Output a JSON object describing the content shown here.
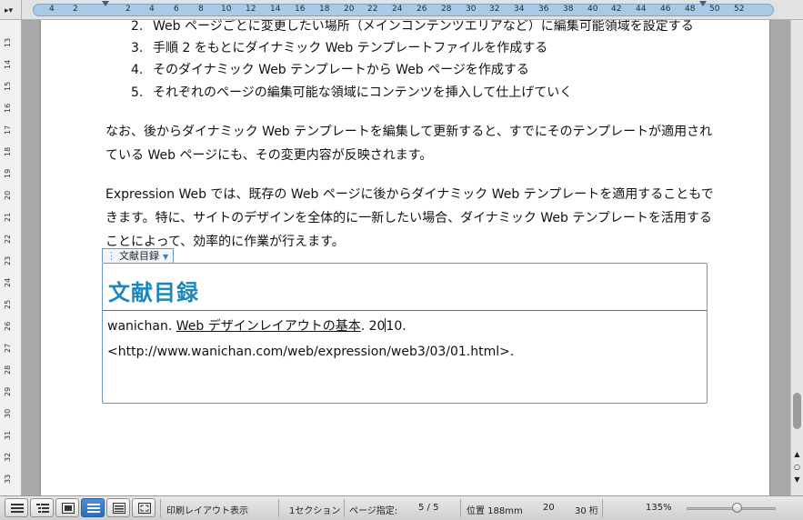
{
  "ruler": {
    "corner_icon": "tab-selector-icon",
    "ticks": [
      "4",
      "2",
      "2",
      "4",
      "6",
      "8",
      "10",
      "12",
      "14",
      "16",
      "18",
      "20",
      "22",
      "24",
      "26",
      "28",
      "30",
      "32",
      "34",
      "36",
      "38",
      "40",
      "42",
      "44",
      "46",
      "48",
      "50",
      "52"
    ],
    "vertical_ticks": [
      "13",
      "14",
      "15",
      "16",
      "17",
      "18",
      "19",
      "20",
      "21",
      "22",
      "23",
      "24",
      "25",
      "26",
      "27",
      "28",
      "29",
      "30",
      "31",
      "32",
      "33"
    ]
  },
  "document": {
    "list_items": [
      {
        "num": "2.",
        "text": "Web ページごとに変更したい場所（メインコンテンツエリアなど）に編集可能領域を設定する"
      },
      {
        "num": "3.",
        "text": "手順 2 をもとにダイナミック Web テンプレートファイルを作成する"
      },
      {
        "num": "4.",
        "text": "そのダイナミック Web テンプレートから Web ページを作成する"
      },
      {
        "num": "5.",
        "text": "それぞれのページの編集可能な領域にコンテンツを挿入して仕上げていく"
      }
    ],
    "para1": "なお、後からダイナミック Web テンプレートを編集して更新すると、すでにそのテンプレートが適用されている Web ページにも、その変更内容が反映されます。",
    "para2": "Expression Web では、既存の Web ページに後からダイナミック Web テンプレートを適用することもできます。特に、サイトのデザインを全体的に一新したい場合、ダイナミック Web テンプレートを活用することによって、効率的に作業が行えます。",
    "tag_label": "文献目録",
    "bibliography": {
      "heading": "文献目録",
      "author": "wanichan.",
      "title": "Web デザインレイアウトの基本",
      "year_part1": ". 20",
      "year_part2": "10.",
      "url": "<http://www.wanichan.com/web/expression/web3/03/01.html>."
    }
  },
  "statusbar": {
    "view_buttons": [
      "outline-view-icon",
      "list-view-icon",
      "publishing-view-icon",
      "print-layout-view-icon",
      "notebook-view-icon",
      "full-screen-view-icon"
    ],
    "active_view": 3,
    "view_name": "印刷レイアウト表示",
    "section": "1セクション",
    "page_label": "ページ指定:",
    "page_value": "5 / 5",
    "position": "位置 188mm",
    "line": "20",
    "column": "30 桁",
    "zoom_level": "135%"
  },
  "colors": {
    "heading": "#1f86b8",
    "region_border": "#6d96c3",
    "ruler_bar": "#aac9e6",
    "active_view": "#3a7fc9"
  }
}
